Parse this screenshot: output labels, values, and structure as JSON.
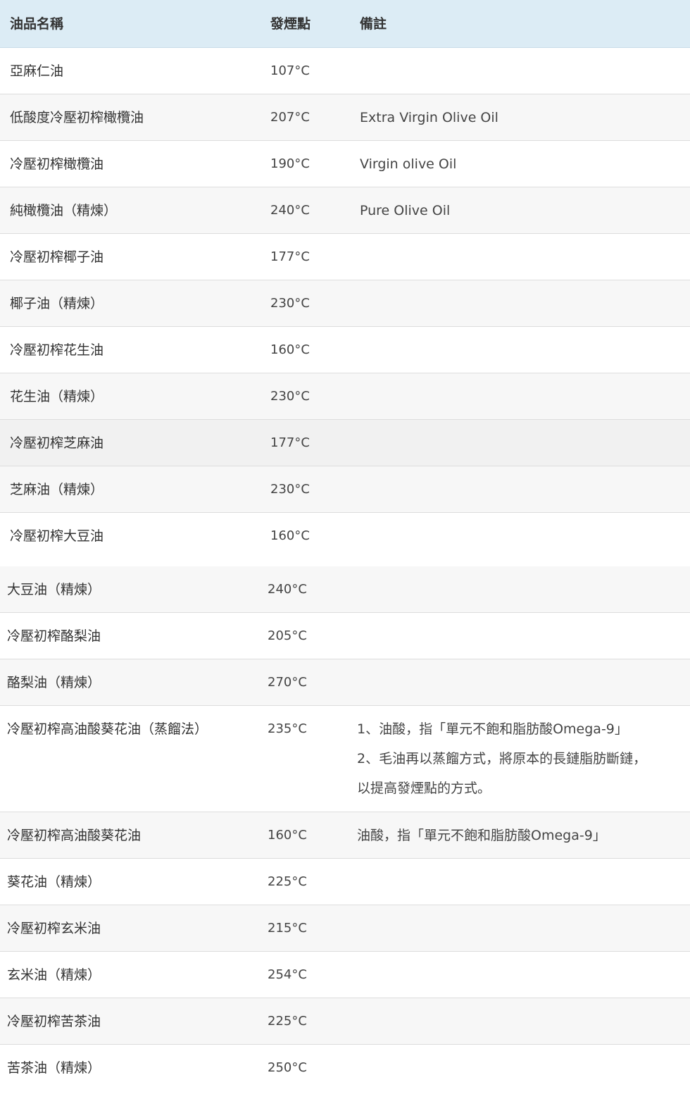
{
  "table": {
    "headers": {
      "name": "油品名稱",
      "smoke_point": "發煙點",
      "note": "備註"
    },
    "rows": [
      {
        "name": "亞麻仁油",
        "smoke_point": "107°C",
        "note": ""
      },
      {
        "name": "低酸度冷壓初榨橄欖油",
        "smoke_point": "207°C",
        "note": "Extra Virgin Olive Oil"
      },
      {
        "name": "冷壓初榨橄欖油",
        "smoke_point": "190°C",
        "note": "Virgin olive Oil"
      },
      {
        "name": "純橄欖油（精煉）",
        "smoke_point": "240°C",
        "note": "Pure Olive Oil"
      },
      {
        "name": "冷壓初榨椰子油",
        "smoke_point": "177°C",
        "note": ""
      },
      {
        "name": "椰子油（精煉）",
        "smoke_point": "230°C",
        "note": ""
      },
      {
        "name": "冷壓初榨花生油",
        "smoke_point": "160°C",
        "note": ""
      },
      {
        "name": "花生油（精煉）",
        "smoke_point": "230°C",
        "note": ""
      },
      {
        "name": "冷壓初榨芝麻油",
        "smoke_point": "177°C",
        "note": ""
      },
      {
        "name": "芝麻油（精煉）",
        "smoke_point": "230°C",
        "note": ""
      },
      {
        "name": "冷壓初榨大豆油",
        "smoke_point": "160°C",
        "note": ""
      },
      {
        "name": "大豆油（精煉）",
        "smoke_point": "240°C",
        "note": ""
      },
      {
        "name": "冷壓初榨酪梨油",
        "smoke_point": "205°C",
        "note": ""
      },
      {
        "name": "酪梨油（精煉）",
        "smoke_point": "270°C",
        "note": ""
      },
      {
        "name": "冷壓初榨高油酸葵花油（蒸餾法）",
        "smoke_point": "235°C",
        "note_lines": [
          "1、油酸，指「單元不飽和脂肪酸Omega-9」",
          "2、毛油再以蒸餾方式，將原本的長鏈脂肪斷鏈，",
          "以提高發煙點的方式。"
        ]
      },
      {
        "name": "冷壓初榨高油酸葵花油",
        "smoke_point": "160°C",
        "note": "油酸，指「單元不飽和脂肪酸Omega-9」"
      },
      {
        "name": "葵花油（精煉）",
        "smoke_point": "225°C",
        "note": ""
      },
      {
        "name": "冷壓初榨玄米油",
        "smoke_point": "215°C",
        "note": ""
      },
      {
        "name": "玄米油（精煉）",
        "smoke_point": "254°C",
        "note": ""
      },
      {
        "name": "冷壓初榨苦茶油",
        "smoke_point": "225°C",
        "note": ""
      },
      {
        "name": "苦茶油（精煉）",
        "smoke_point": "250°C",
        "note": ""
      }
    ]
  }
}
